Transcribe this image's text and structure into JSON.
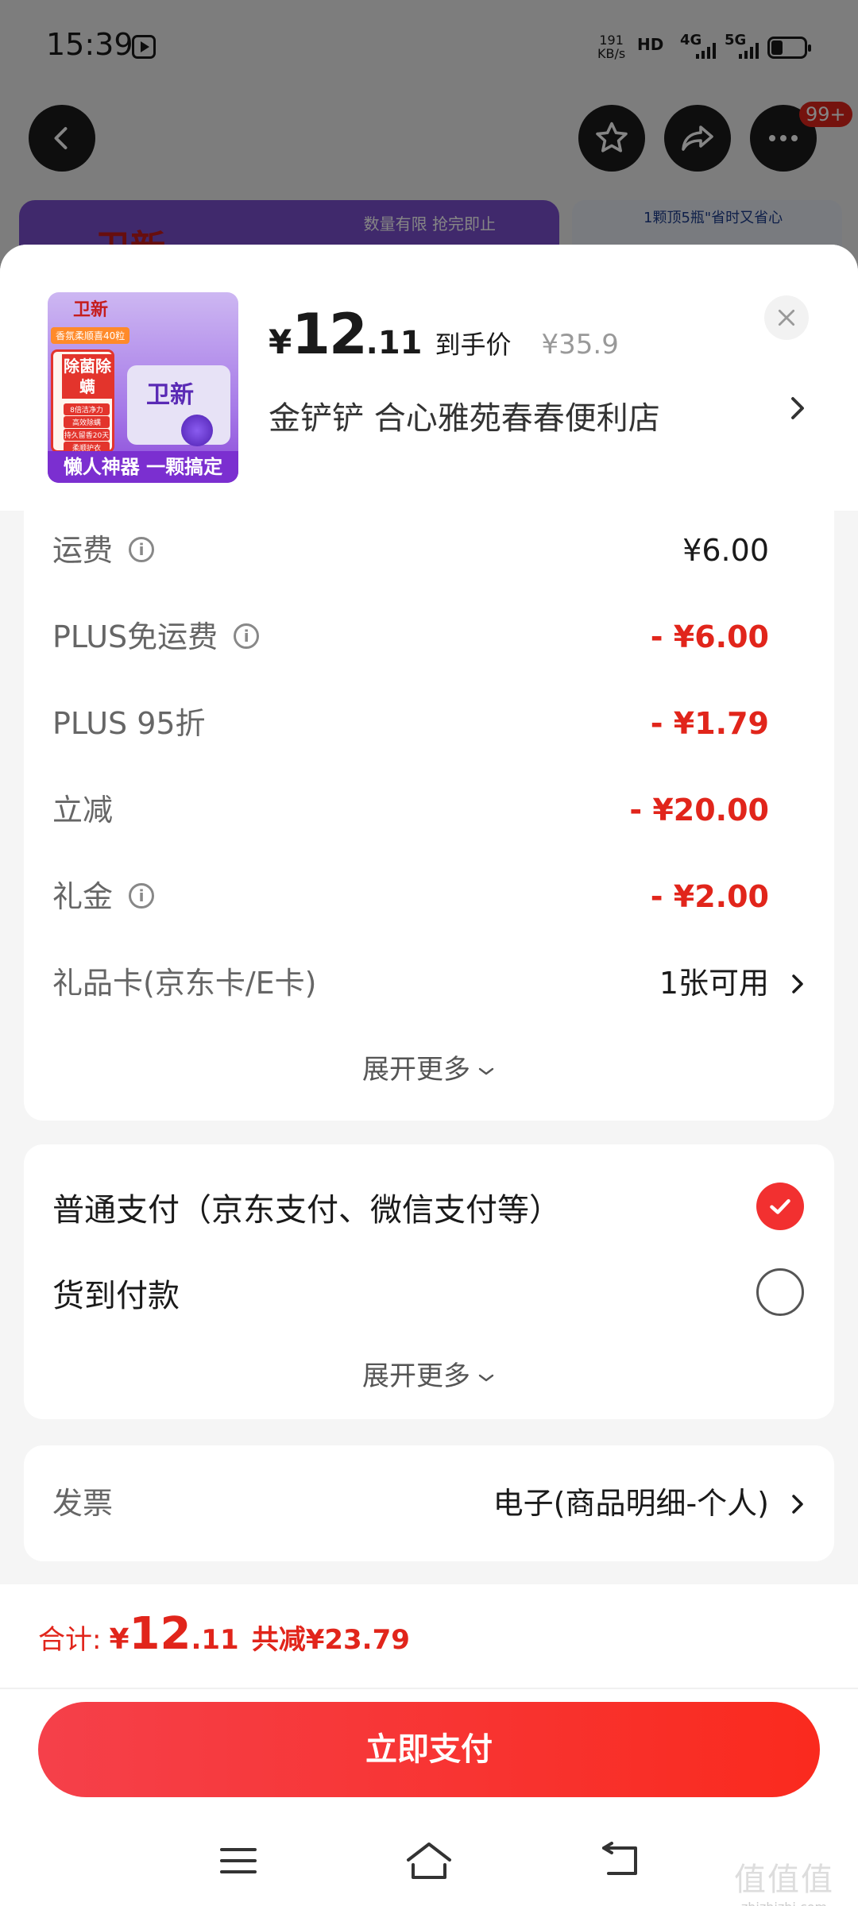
{
  "status_bar": {
    "time": "15:39",
    "net_speed": "191",
    "net_unit": "KB/s",
    "hd": "HD",
    "sim1": "4G",
    "sim2": "5G"
  },
  "top_nav": {
    "notification_badge": "99+"
  },
  "background_banners": {
    "left_logo": "卫新",
    "left_text": "数量有限 抢完即止",
    "right_text": "1颗顶5瓶\"省时又省心"
  },
  "product": {
    "thumbnail": {
      "logo": "卫新",
      "tag": "香氛柔顺喜40粒",
      "headline": "除菌除螨",
      "features": [
        "8倍洁净力",
        "高效除螨",
        "持久留香20天",
        "柔顺护衣"
      ],
      "pack_logo": "卫新",
      "bottom_banner": "懒人神器 一颗搞定"
    },
    "currency": "¥",
    "price_int": "12",
    "price_dec": ".11",
    "price_label": "到手价",
    "original_price": "¥35.9",
    "shop_line": "金铲铲  合心雅苑春春便利店"
  },
  "fees": {
    "rows": [
      {
        "label": "运费",
        "value": "¥6.00"
      },
      {
        "label": "PLUS免运费",
        "value": "- ¥6.00"
      },
      {
        "label": "PLUS 95折",
        "value": "- ¥1.79"
      },
      {
        "label": "立减",
        "value": "- ¥20.00"
      },
      {
        "label": "礼金",
        "value": "- ¥2.00"
      },
      {
        "label": "礼品卡(京东卡/E卡)",
        "value": "1张可用"
      }
    ],
    "expand_more": "展开更多"
  },
  "payment": {
    "options": [
      {
        "label": "普通支付（京东支付、微信支付等）",
        "selected": true
      },
      {
        "label": "货到付款",
        "selected": false
      }
    ],
    "expand_more": "展开更多"
  },
  "invoice": {
    "label": "发票",
    "value": "电子(商品明细-个人)"
  },
  "footer": {
    "total_label": "合计:",
    "total_cur": "¥",
    "total_int": "12",
    "total_dec": ".11",
    "saved": "共减¥23.79",
    "pay_button": "立即支付"
  },
  "watermark": {
    "glyphs": "值值值",
    "site": "zhizhizhi.com"
  },
  "colors": {
    "accent_red": "#e1251b",
    "pay_button": "#f5404a",
    "checked_radio": "#f23030"
  }
}
